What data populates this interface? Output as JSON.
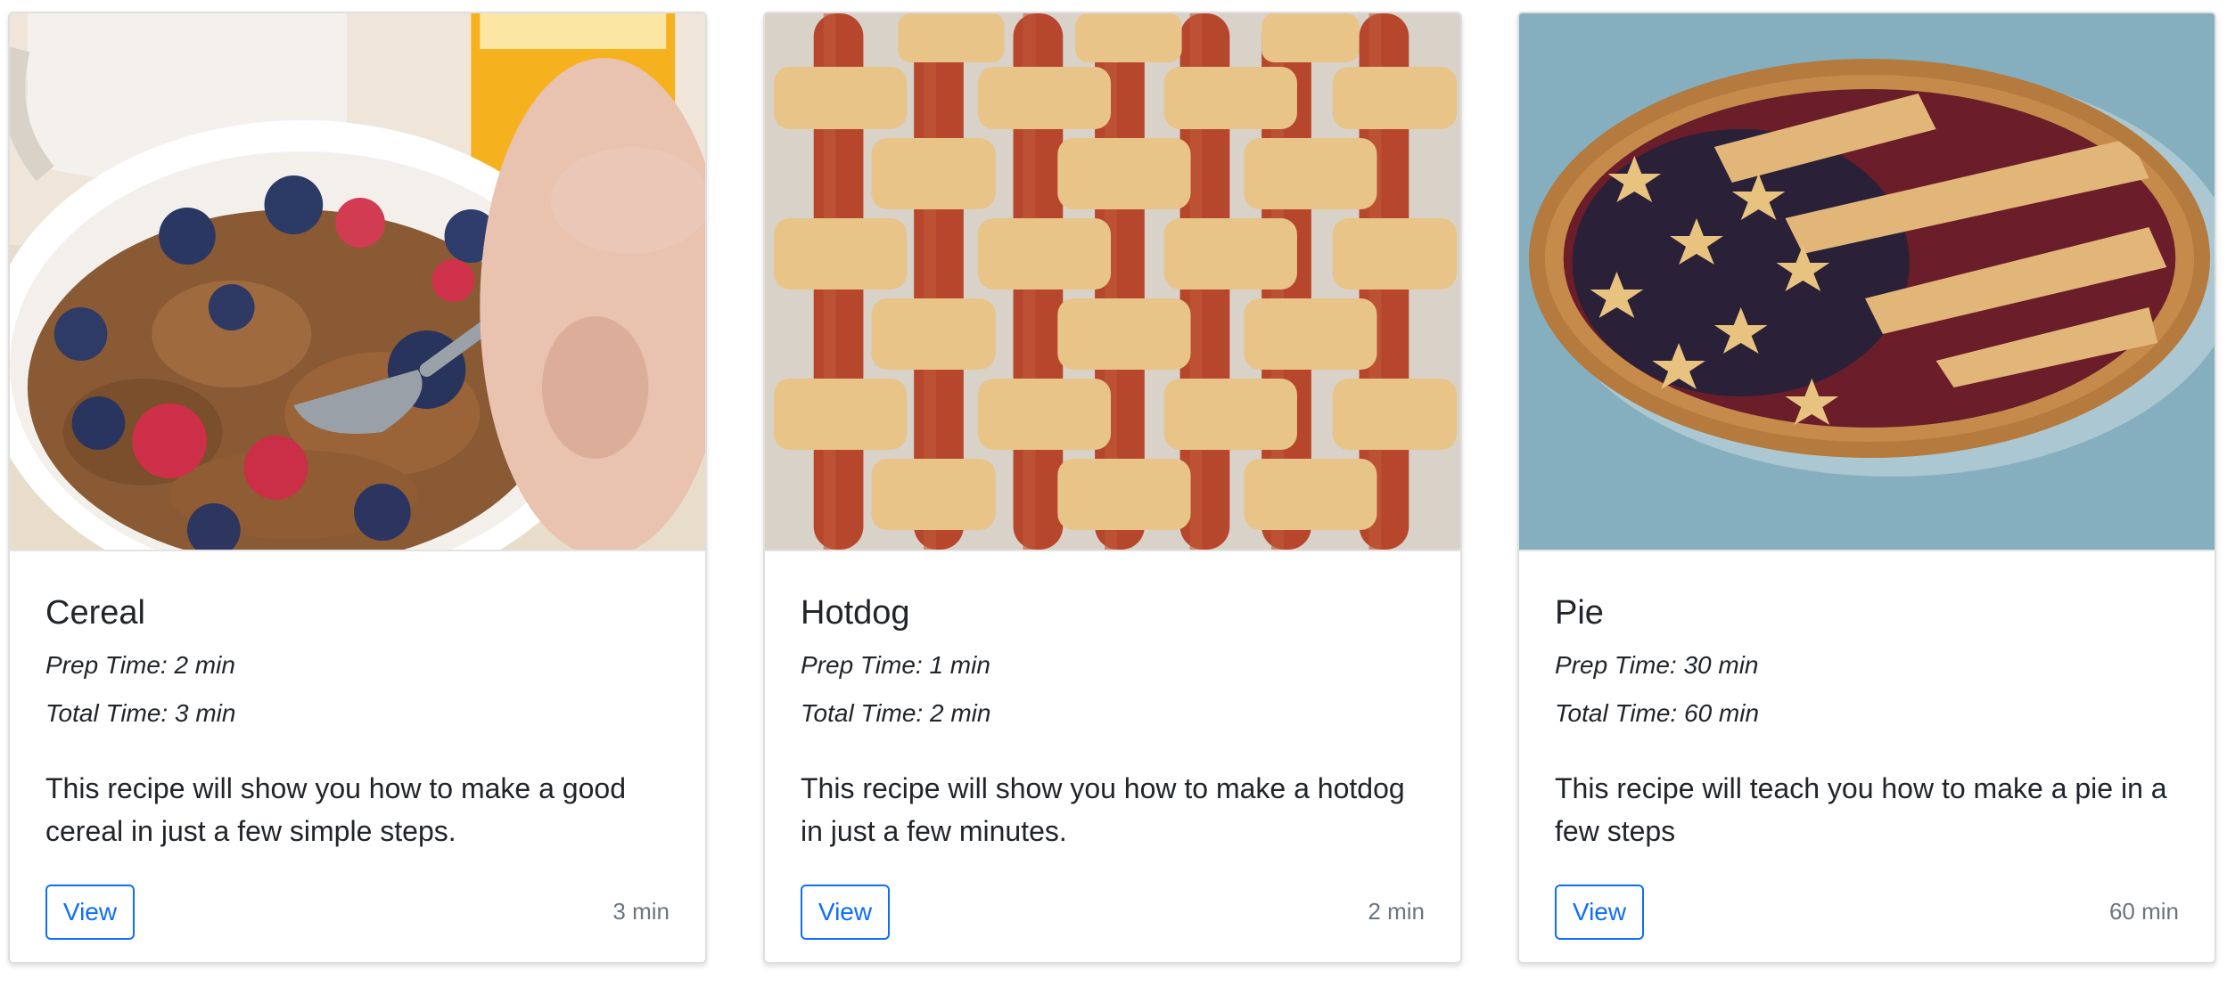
{
  "recipes": [
    {
      "title": "Cereal",
      "prep_time": "Prep Time: 2 min",
      "total_time": "Total Time: 3 min",
      "description": "This recipe will show you how to make a good cereal in just a few simple steps.",
      "view_label": "View",
      "time_note": "3 min",
      "image_alt": "cereal-bowl-photo"
    },
    {
      "title": "Hotdog",
      "prep_time": "Prep Time: 1 min",
      "total_time": "Total Time: 2 min",
      "description": "This recipe will show you how to make a hotdog in just a few minutes.",
      "view_label": "View",
      "time_note": "2 min",
      "image_alt": "hotdog-lattice-photo"
    },
    {
      "title": "Pie",
      "prep_time": "Prep Time: 30 min",
      "total_time": "Total Time: 60 min",
      "description": "This recipe will teach you how to make a pie in a few steps",
      "view_label": "View",
      "time_note": "60 min",
      "image_alt": "flag-pie-photo"
    }
  ],
  "colors": {
    "primary": "#0d6efd",
    "muted": "#6c757d",
    "text": "#212529",
    "border": "#dfdfdf"
  }
}
